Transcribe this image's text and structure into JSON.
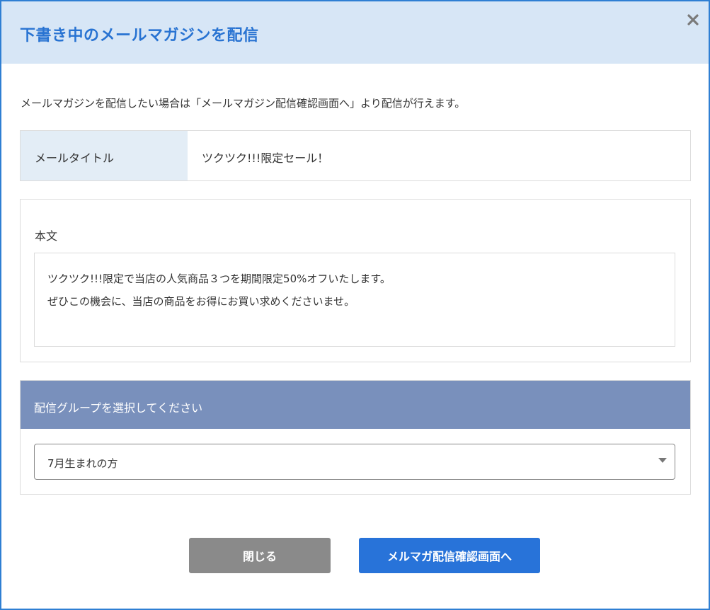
{
  "dialog": {
    "title": "下書き中のメールマガジンを配信",
    "intro": "メールマガジンを配信したい場合は「メールマガジン配信確認画面へ」より配信が行えます。"
  },
  "mail_title": {
    "label": "メールタイトル",
    "value": "ツクツク!!!限定セール！"
  },
  "body": {
    "label": "本文",
    "lines": [
      "ツクツク!!!限定で当店の人気商品３つを期間限定50%オフいたします。",
      "ぜひこの機会に、当店の商品をお得にお買い求めくださいませ。"
    ]
  },
  "group": {
    "header": "配信グループを選択してください",
    "selected": "7月生まれの方"
  },
  "buttons": {
    "close_label": "閉じる",
    "confirm_label": "メルマガ配信確認画面へ"
  },
  "icons": {
    "close": "close-icon",
    "dropdown": "caret-down-icon"
  },
  "colors": {
    "accent": "#2873d9",
    "header_bg": "#d7e6f6",
    "group_header_bg": "#7990bc",
    "close_button_bg": "#8a8a8a"
  }
}
